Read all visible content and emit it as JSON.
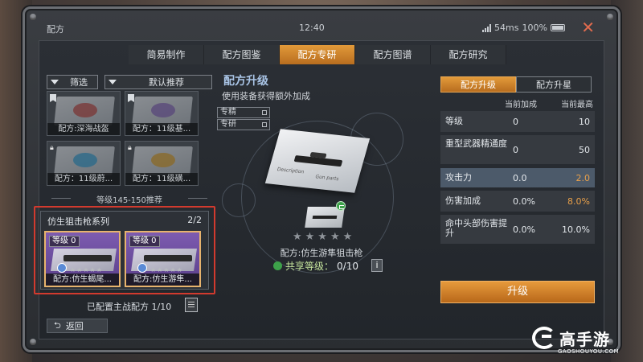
{
  "window": {
    "title": "配方",
    "time": "12:40",
    "latency": "54ms",
    "battery": "100%"
  },
  "tabs": [
    {
      "label": "简易制作",
      "active": false
    },
    {
      "label": "配方图鉴",
      "active": false
    },
    {
      "label": "配方专研",
      "active": true
    },
    {
      "label": "配方图谱",
      "active": false
    },
    {
      "label": "配方研究",
      "active": false
    }
  ],
  "filters": {
    "filter_label": "筛选",
    "sort_label": "默认推荐"
  },
  "recipe_cards": [
    {
      "label": "配方:深海战盔",
      "icon": "flag-icon"
    },
    {
      "label": "配方：11级基...",
      "icon": "flag-icon"
    },
    {
      "label": "配方：11级蔚...",
      "icon": "lock-icon"
    },
    {
      "label": "配方：11级磺...",
      "icon": "lock-icon"
    }
  ],
  "level_range": "等级145-150推荐",
  "series": {
    "title": "仿生狙击枪系列",
    "count": "2/2",
    "cards": [
      {
        "level": "等级 0",
        "label": "配方:仿生蝎尾...",
        "stars": "★★★★★"
      },
      {
        "level": "等级 0",
        "label": "配方:仿生游隼...",
        "stars": "★★★★★"
      }
    ]
  },
  "configured": "已配置主战配方 1/10",
  "back_label": "返回",
  "middle": {
    "title": "配方升级",
    "subtitle": "使用装备获得额外加成",
    "specs": [
      "专精",
      "专研"
    ],
    "blueprint_text": [
      "Description",
      "Gun parts"
    ],
    "stars": "★★★★★",
    "gun_name": "配方:仿生游隼狙击枪",
    "share_label": "共享等级：",
    "share_value": "0/10",
    "info": "i"
  },
  "right": {
    "tabs": [
      {
        "label": "配方升级",
        "active": true
      },
      {
        "label": "配方升星",
        "active": false
      }
    ],
    "col_current": "当前加成",
    "col_max": "当前最高",
    "stats": [
      {
        "name": "等级",
        "current": "0",
        "max": "10",
        "highlight": false,
        "orange": false
      },
      {
        "name": "重型武器精通度",
        "current": "0",
        "max": "50",
        "highlight": false,
        "orange": false
      },
      {
        "name": "攻击力",
        "current": "0.0",
        "max": "2.0",
        "highlight": true,
        "orange": true
      },
      {
        "name": "伤害加成",
        "current": "0.0%",
        "max": "8.0%",
        "highlight": false,
        "orange": true
      },
      {
        "name": "命中头部伤害提升",
        "current": "0.0%",
        "max": "10.0%",
        "highlight": false,
        "orange": false
      }
    ],
    "upgrade_label": "升级"
  },
  "brand": {
    "name": "高手游",
    "url": "GAOSHOUYOU.COM"
  },
  "colors": {
    "accent": "#e29a3a",
    "highlight_red": "#d23a2e",
    "stat_highlight": "#4c5a6a"
  }
}
